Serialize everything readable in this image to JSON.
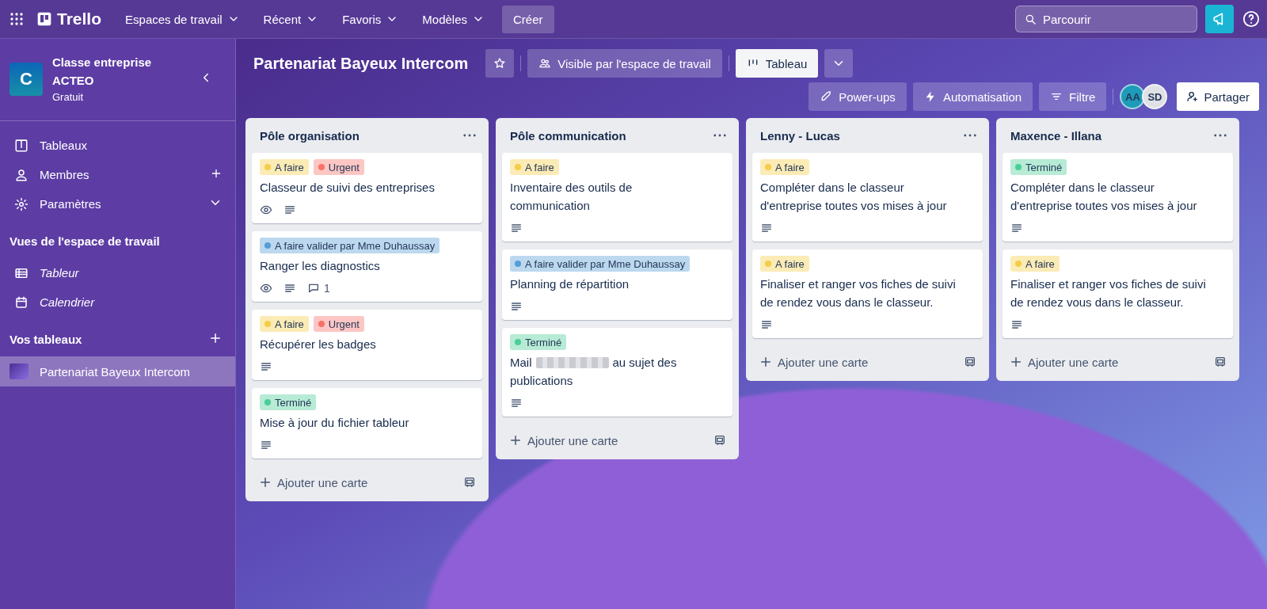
{
  "topbar": {
    "logo": "Trello",
    "menus": [
      {
        "label": "Espaces de travail"
      },
      {
        "label": "Récent"
      },
      {
        "label": "Favoris"
      },
      {
        "label": "Modèles"
      }
    ],
    "create": "Créer",
    "search": {
      "placeholder": "Parcourir"
    }
  },
  "sidebar": {
    "workspace": {
      "initial": "C",
      "name": "Classe entreprise ACTEO",
      "plan": "Gratuit"
    },
    "items": [
      {
        "label": "Tableaux"
      },
      {
        "label": "Membres"
      },
      {
        "label": "Paramètres"
      }
    ],
    "views_heading": "Vues de l'espace de travail",
    "views": [
      {
        "label": "Tableur"
      },
      {
        "label": "Calendrier"
      }
    ],
    "boards_heading": "Vos tableaux",
    "boards": [
      {
        "label": "Partenariat Bayeux Intercom",
        "selected": true
      }
    ]
  },
  "board": {
    "title": "Partenariat Bayeux Intercom",
    "visibility": "Visible par l'espace de travail",
    "view": "Tableau",
    "buttons": [
      {
        "label": "Power-ups"
      },
      {
        "label": "Automatisation"
      },
      {
        "label": "Filtre"
      }
    ],
    "members": [
      {
        "initials": "AA",
        "color": "#1d9bb8"
      },
      {
        "initials": "SD",
        "color": "#dfe1e6"
      }
    ],
    "share": "Partager"
  },
  "lists": [
    {
      "title": "Pôle organisation",
      "add_card": "Ajouter une carte",
      "cards": [
        {
          "labels": [
            {
              "text": "A faire",
              "color": "#f5cd47"
            },
            {
              "text": "Urgent",
              "color": "#f87168"
            }
          ],
          "title": "Classeur de suivi des entreprises",
          "watching": true,
          "description": true
        },
        {
          "labels": [
            {
              "text": "A faire valider par Mme Duhaussay",
              "color": "#579dd6"
            }
          ],
          "title": "Ranger les diagnostics",
          "watching": true,
          "description": true,
          "comments": "1"
        },
        {
          "labels": [
            {
              "text": "A faire",
              "color": "#f5cd47"
            },
            {
              "text": "Urgent",
              "color": "#f87168"
            }
          ],
          "title": "Récupérer les badges",
          "watching": false,
          "description": true
        },
        {
          "labels": [
            {
              "text": "Terminé",
              "color": "#4bce97"
            }
          ],
          "title": "Mise à jour du fichier tableur",
          "watching": false,
          "description": true
        }
      ]
    },
    {
      "title": "Pôle communication",
      "add_card": "Ajouter une carte",
      "cards": [
        {
          "labels": [
            {
              "text": "A faire",
              "color": "#f5cd47"
            }
          ],
          "title": "Inventaire des outils de communication",
          "watching": false,
          "description": true
        },
        {
          "labels": [
            {
              "text": "A faire valider par Mme Duhaussay",
              "color": "#579dd6"
            }
          ],
          "title": "Planning de répartition",
          "watching": false,
          "description": true
        },
        {
          "labels": [
            {
              "text": "Terminé",
              "color": "#4bce97"
            }
          ],
          "title": "Mail",
          "redacted": true,
          "title_rest": "au sujet des",
          "title_line2": "publications",
          "watching": false,
          "description": true
        }
      ]
    },
    {
      "title": "Lenny - Lucas",
      "add_card": "Ajouter une carte",
      "cards": [
        {
          "labels": [
            {
              "text": "A faire",
              "color": "#f5cd47"
            }
          ],
          "title": "Compléter dans le classeur d'entreprise toutes vos mises à jour",
          "watching": false,
          "description": true
        },
        {
          "labels": [
            {
              "text": "A faire",
              "color": "#f5cd47"
            }
          ],
          "title": "Finaliser et ranger vos fiches de suivi de rendez vous dans le classeur.",
          "watching": false,
          "description": true
        }
      ]
    },
    {
      "title": "Maxence - Illana",
      "add_card": "Ajouter une carte",
      "cards": [
        {
          "labels": [
            {
              "text": "Terminé",
              "color": "#4bce97"
            }
          ],
          "title": "Compléter dans le classeur d'entreprise toutes vos mises à jour",
          "watching": false,
          "description": true
        },
        {
          "labels": [
            {
              "text": "A faire",
              "color": "#f5cd47"
            }
          ],
          "title": "Finaliser et ranger vos fiches de suivi de rendez vous dans le classeur.",
          "watching": false,
          "description": true
        }
      ]
    }
  ]
}
